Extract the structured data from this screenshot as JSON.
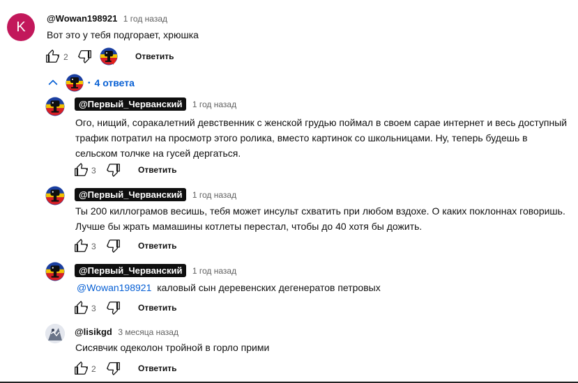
{
  "comment": {
    "avatar_letter": "K",
    "author": "@Wowan198921",
    "time": "1 год назад",
    "text": "Вот это у тебя подгорает, хрюшка",
    "likes": "2",
    "reply_label": "Ответить"
  },
  "replies_toggle": {
    "bullet": "•",
    "label": "4 ответа"
  },
  "replies": [
    {
      "author": "@Первый_Черванский",
      "time": "1 год назад",
      "lines": [
        "Ого, нищий, соракалетний девственник с женской грудью поймал в своем сарае интернет и весь  доступный",
        "трафик потратил на просмотр этого ролика, вместо картинок со школьницами. Ну, теперь будешь в",
        "сельском толчке на гусей дергаться."
      ],
      "likes": "3",
      "reply_label": "Ответить"
    },
    {
      "author": "@Первый_Черванский",
      "time": "1 год назад",
      "lines": [
        "Ты 200 киллограмов весишь, тебя может инсульт схватить при любом вздохе. О каких поклоннах говоришь.",
        "Лучше бы жрать мамашины котлеты перестал, чтобы до 40 хотя бы  дожить."
      ],
      "likes": "3",
      "reply_label": "Ответить"
    },
    {
      "author": "@Первый_Черванский",
      "time": "1 год назад",
      "mention": "@Wowan198921",
      "text": "каловый сын деревенских дегенератов петровых",
      "likes": "3",
      "reply_label": "Ответить"
    },
    {
      "author": "@lisikgd",
      "time": "3 месяца назад",
      "text": "Сисявчик одеколон тройной в горло прими",
      "likes": "2",
      "reply_label": "Ответить"
    }
  ],
  "colors": {
    "avatar_k": "#c2185b",
    "link": "#065fd4",
    "chip": "#0f0f0f"
  }
}
